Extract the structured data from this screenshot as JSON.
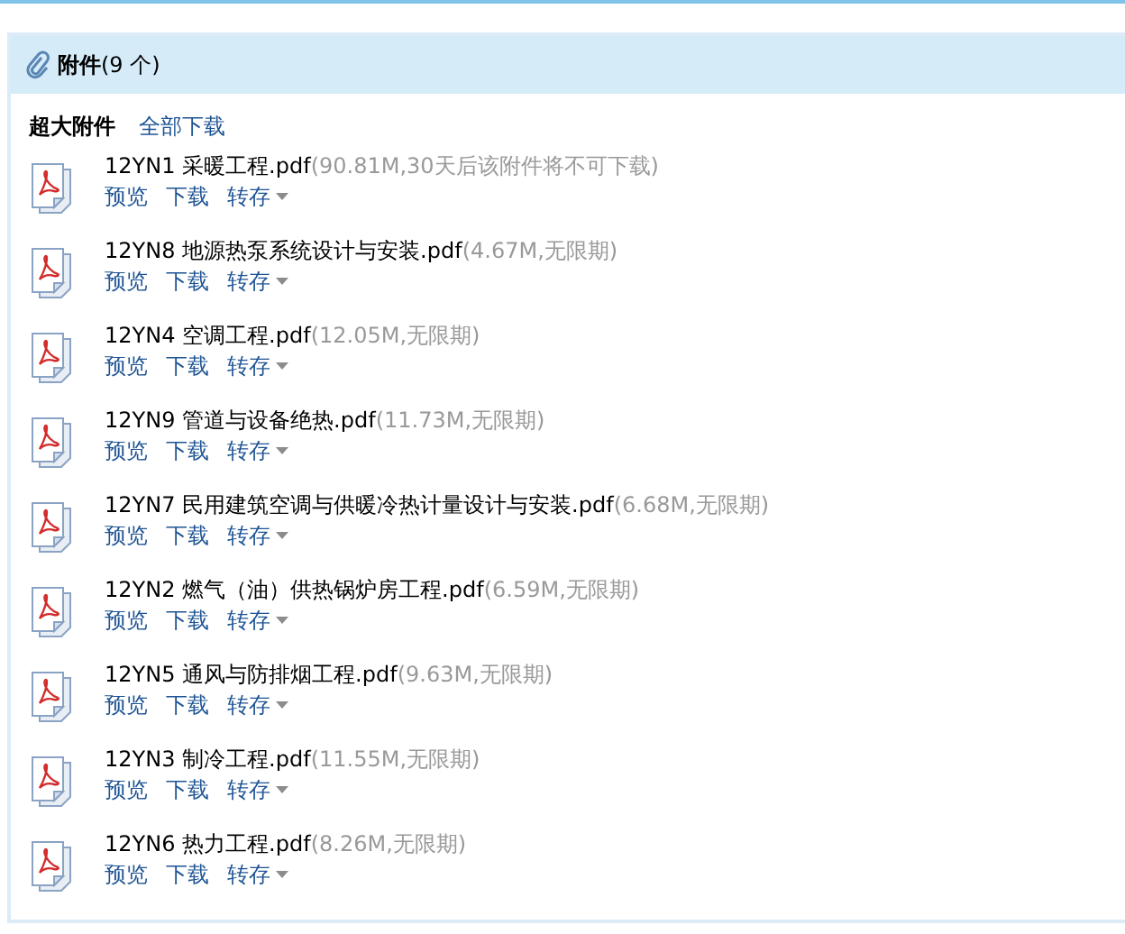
{
  "header": {
    "title": "附件",
    "count": "(9 个)"
  },
  "toolbar": {
    "label": "超大附件",
    "link": "全部下载"
  },
  "files": [
    {
      "name": "12YN1 采暖工程.pdf",
      "info": "(90.81M,30天后该附件将不可下载)",
      "actions": [
        "预览",
        "下载",
        "转存"
      ]
    },
    {
      "name": "12YN8 地源热泵系统设计与安装.pdf",
      "info": "(4.67M,无限期)",
      "actions": [
        "预览",
        "下载",
        "转存"
      ]
    },
    {
      "name": "12YN4 空调工程.pdf",
      "info": "(12.05M,无限期)",
      "actions": [
        "预览",
        "下载",
        "转存"
      ]
    },
    {
      "name": "12YN9 管道与设备绝热.pdf",
      "info": "(11.73M,无限期)",
      "actions": [
        "预览",
        "下载",
        "转存"
      ]
    },
    {
      "name": "12YN7 民用建筑空调与供暖冷热计量设计与安装.pdf",
      "info": "(6.68M,无限期)",
      "actions": [
        "预览",
        "下载",
        "转存"
      ]
    },
    {
      "name": "12YN2 燃气（油）供热锅炉房工程.pdf",
      "info": "(6.59M,无限期)",
      "actions": [
        "预览",
        "下载",
        "转存"
      ]
    },
    {
      "name": "12YN5 通风与防排烟工程.pdf",
      "info": "(9.63M,无限期)",
      "actions": [
        "预览",
        "下载",
        "转存"
      ]
    },
    {
      "name": "12YN3 制冷工程.pdf",
      "info": "(11.55M,无限期)",
      "actions": [
        "预览",
        "下载",
        "转存"
      ]
    },
    {
      "name": "12YN6 热力工程.pdf",
      "info": "(8.26M,无限期)",
      "actions": [
        "预览",
        "下载",
        "转存"
      ]
    }
  ]
}
